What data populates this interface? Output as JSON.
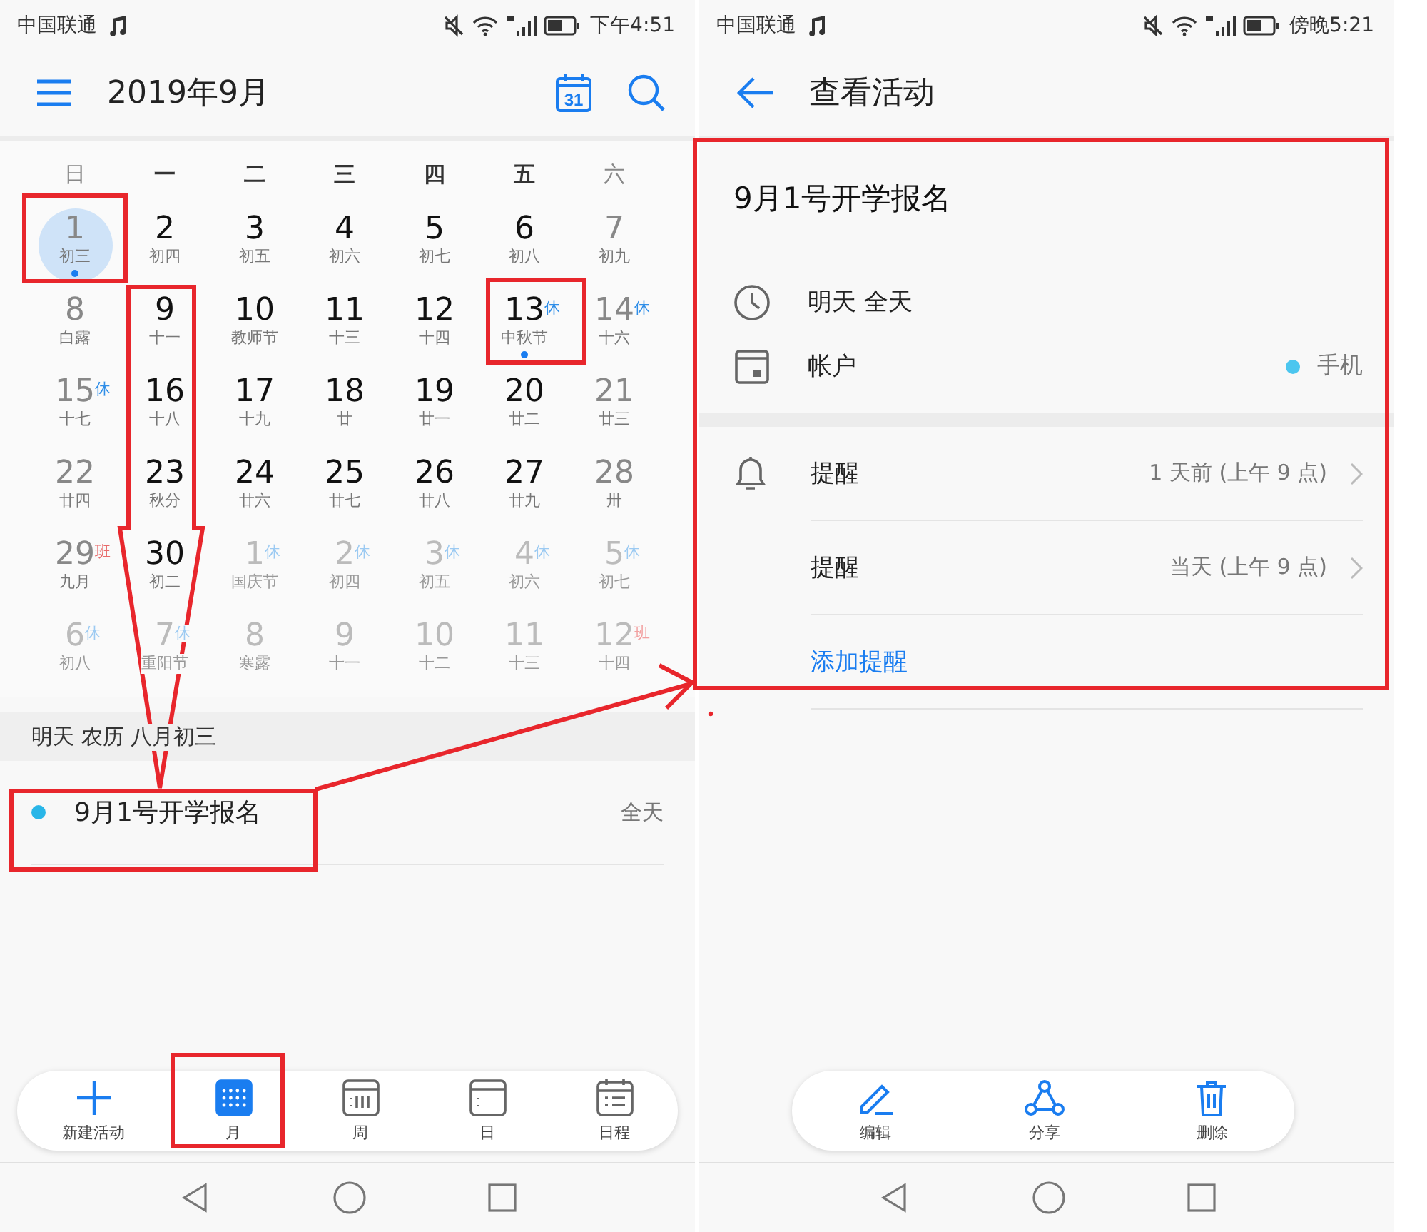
{
  "left": {
    "status_bar": {
      "carrier": "中国联通",
      "time": "下午4:51"
    },
    "header": {
      "title": "2019年9月",
      "today_icon_text": "31"
    },
    "weekdays": [
      {
        "label": "日",
        "weekend": true
      },
      {
        "label": "一",
        "weekend": false
      },
      {
        "label": "二",
        "weekend": false
      },
      {
        "label": "三",
        "weekend": false
      },
      {
        "label": "四",
        "weekend": false
      },
      {
        "label": "五",
        "weekend": false
      },
      {
        "label": "六",
        "weekend": true
      }
    ],
    "cells": [
      {
        "day": "1",
        "lunar": "初三",
        "kind": "weekend",
        "selected": true,
        "event": true
      },
      {
        "day": "2",
        "lunar": "初四",
        "kind": "weekday",
        "selected": false,
        "event": false
      },
      {
        "day": "3",
        "lunar": "初五",
        "kind": "weekday",
        "selected": false,
        "event": false
      },
      {
        "day": "4",
        "lunar": "初六",
        "kind": "weekday",
        "selected": false,
        "event": false
      },
      {
        "day": "5",
        "lunar": "初七",
        "kind": "weekday",
        "selected": false,
        "event": false
      },
      {
        "day": "6",
        "lunar": "初八",
        "kind": "weekday",
        "selected": false,
        "event": false
      },
      {
        "day": "7",
        "lunar": "初九",
        "kind": "weekend",
        "selected": false,
        "event": false
      },
      {
        "day": "8",
        "lunar": "白露",
        "kind": "weekend",
        "selected": false,
        "event": false
      },
      {
        "day": "9",
        "lunar": "十一",
        "kind": "weekday",
        "selected": false,
        "event": false
      },
      {
        "day": "10",
        "lunar": "教师节",
        "kind": "weekday",
        "selected": false,
        "event": false
      },
      {
        "day": "11",
        "lunar": "十三",
        "kind": "weekday",
        "selected": false,
        "event": false
      },
      {
        "day": "12",
        "lunar": "十四",
        "kind": "weekday",
        "selected": false,
        "event": false
      },
      {
        "day": "13",
        "lunar": "中秋节",
        "kind": "weekday",
        "selected": false,
        "event": true,
        "badge": {
          "text": "休",
          "kind": "rest"
        }
      },
      {
        "day": "14",
        "lunar": "十六",
        "kind": "weekend",
        "selected": false,
        "event": false,
        "badge": {
          "text": "休",
          "kind": "rest"
        }
      },
      {
        "day": "15",
        "lunar": "十七",
        "kind": "weekend",
        "selected": false,
        "event": false,
        "badge": {
          "text": "休",
          "kind": "rest"
        }
      },
      {
        "day": "16",
        "lunar": "十八",
        "kind": "weekday",
        "selected": false,
        "event": false
      },
      {
        "day": "17",
        "lunar": "十九",
        "kind": "weekday",
        "selected": false,
        "event": false
      },
      {
        "day": "18",
        "lunar": "廿",
        "kind": "weekday",
        "selected": false,
        "event": false
      },
      {
        "day": "19",
        "lunar": "廿一",
        "kind": "weekday",
        "selected": false,
        "event": false
      },
      {
        "day": "20",
        "lunar": "廿二",
        "kind": "weekday",
        "selected": false,
        "event": false
      },
      {
        "day": "21",
        "lunar": "廿三",
        "kind": "weekend",
        "selected": false,
        "event": false
      },
      {
        "day": "22",
        "lunar": "廿四",
        "kind": "weekend",
        "selected": false,
        "event": false
      },
      {
        "day": "23",
        "lunar": "秋分",
        "kind": "weekday",
        "selected": false,
        "event": false
      },
      {
        "day": "24",
        "lunar": "廿六",
        "kind": "weekday",
        "selected": false,
        "event": false
      },
      {
        "day": "25",
        "lunar": "廿七",
        "kind": "weekday",
        "selected": false,
        "event": false
      },
      {
        "day": "26",
        "lunar": "廿八",
        "kind": "weekday",
        "selected": false,
        "event": false
      },
      {
        "day": "27",
        "lunar": "廿九",
        "kind": "weekday",
        "selected": false,
        "event": false
      },
      {
        "day": "28",
        "lunar": "卅",
        "kind": "weekend",
        "selected": false,
        "event": false
      },
      {
        "day": "29",
        "lunar": "九月",
        "kind": "weekend",
        "selected": false,
        "event": false,
        "badge": {
          "text": "班",
          "kind": "work"
        }
      },
      {
        "day": "30",
        "lunar": "初二",
        "kind": "weekday",
        "selected": false,
        "event": false
      },
      {
        "day": "1",
        "lunar": "国庆节",
        "kind": "other_month",
        "selected": false,
        "event": false,
        "badge": {
          "text": "休",
          "kind": "rest"
        }
      },
      {
        "day": "2",
        "lunar": "初四",
        "kind": "other_month",
        "selected": false,
        "event": false,
        "badge": {
          "text": "休",
          "kind": "rest"
        }
      },
      {
        "day": "3",
        "lunar": "初五",
        "kind": "other_month",
        "selected": false,
        "event": false,
        "badge": {
          "text": "休",
          "kind": "rest"
        }
      },
      {
        "day": "4",
        "lunar": "初六",
        "kind": "other_month",
        "selected": false,
        "event": false,
        "badge": {
          "text": "休",
          "kind": "rest"
        }
      },
      {
        "day": "5",
        "lunar": "初七",
        "kind": "other_month",
        "selected": false,
        "event": false,
        "badge": {
          "text": "休",
          "kind": "rest"
        }
      },
      {
        "day": "6",
        "lunar": "初八",
        "kind": "other_month",
        "selected": false,
        "event": false,
        "badge": {
          "text": "休",
          "kind": "rest"
        }
      },
      {
        "day": "7",
        "lunar": "重阳节",
        "kind": "other_month",
        "selected": false,
        "event": false,
        "badge": {
          "text": "休",
          "kind": "rest"
        }
      },
      {
        "day": "8",
        "lunar": "寒露",
        "kind": "other_month",
        "selected": false,
        "event": false
      },
      {
        "day": "9",
        "lunar": "十一",
        "kind": "other_month",
        "selected": false,
        "event": false
      },
      {
        "day": "10",
        "lunar": "十二",
        "kind": "other_month",
        "selected": false,
        "event": false
      },
      {
        "day": "11",
        "lunar": "十三",
        "kind": "other_month",
        "selected": false,
        "event": false
      },
      {
        "day": "12",
        "lunar": "十四",
        "kind": "other_month",
        "selected": false,
        "event": false,
        "badge": {
          "text": "班",
          "kind": "work"
        }
      }
    ],
    "day_heading": "明天 农历 八月初三",
    "events": [
      {
        "title": "9月1号开学报名",
        "time": "全天"
      }
    ],
    "bottom_nav": [
      {
        "label": "新建活动",
        "kind": "add",
        "selected": false
      },
      {
        "label": "月",
        "kind": "month",
        "selected": true
      },
      {
        "label": "周",
        "kind": "week",
        "selected": false
      },
      {
        "label": "日",
        "kind": "day",
        "selected": false
      },
      {
        "label": "日程",
        "kind": "agenda",
        "selected": false
      }
    ]
  },
  "right": {
    "status_bar": {
      "carrier": "中国联通",
      "time": "傍晚5:21"
    },
    "header": {
      "title": "查看活动"
    },
    "event_title": "9月1号开学报名",
    "when": "明天 全天",
    "account": {
      "label": "帐户",
      "value": "手机"
    },
    "reminders": [
      {
        "label": "提醒",
        "value": "1 天前 (上午 9 点)"
      },
      {
        "label": "提醒",
        "value": "当天 (上午 9 点)"
      }
    ],
    "add_reminder": "添加提醒",
    "toolbar": [
      {
        "label": "编辑",
        "kind": "edit"
      },
      {
        "label": "分享",
        "kind": "share"
      },
      {
        "label": "删除",
        "kind": "delete"
      }
    ]
  }
}
